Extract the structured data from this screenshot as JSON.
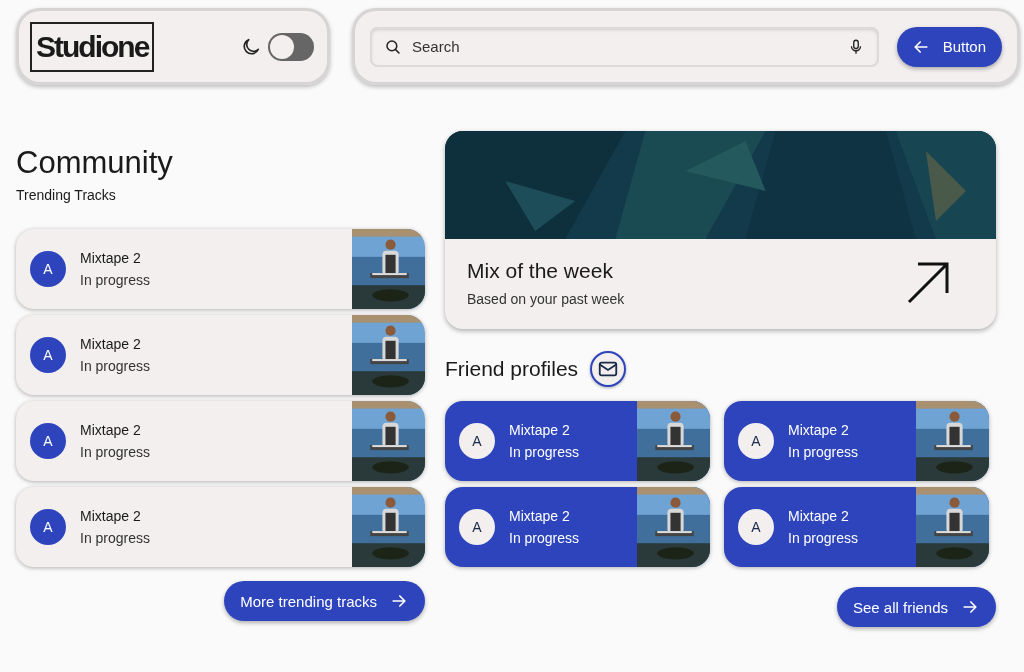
{
  "header": {
    "logo": "Studione",
    "dark_mode": {
      "on": false
    },
    "search": {
      "placeholder": "Search"
    },
    "button": "Button"
  },
  "community": {
    "title": "Community",
    "subtitle": "Trending Tracks",
    "tracks": [
      {
        "avatar": "A",
        "title": "Mixtape 2",
        "status": "In progress"
      },
      {
        "avatar": "A",
        "title": "Mixtape 2",
        "status": "In progress"
      },
      {
        "avatar": "A",
        "title": "Mixtape 2",
        "status": "In progress"
      },
      {
        "avatar": "A",
        "title": "Mixtape 2",
        "status": "In progress"
      }
    ],
    "more_button": "More trending tracks"
  },
  "feature": {
    "title": "Mix of the week",
    "subtitle": "Based on your past week"
  },
  "friends": {
    "title": "Friend profiles",
    "items": [
      {
        "avatar": "A",
        "title": "Mixtape 2",
        "status": "In progress"
      },
      {
        "avatar": "A",
        "title": "Mixtape 2",
        "status": "In progress"
      },
      {
        "avatar": "A",
        "title": "Mixtape 2",
        "status": "In progress"
      },
      {
        "avatar": "A",
        "title": "Mixtape 2",
        "status": "In progress"
      }
    ],
    "see_all_button": "See all friends"
  }
}
